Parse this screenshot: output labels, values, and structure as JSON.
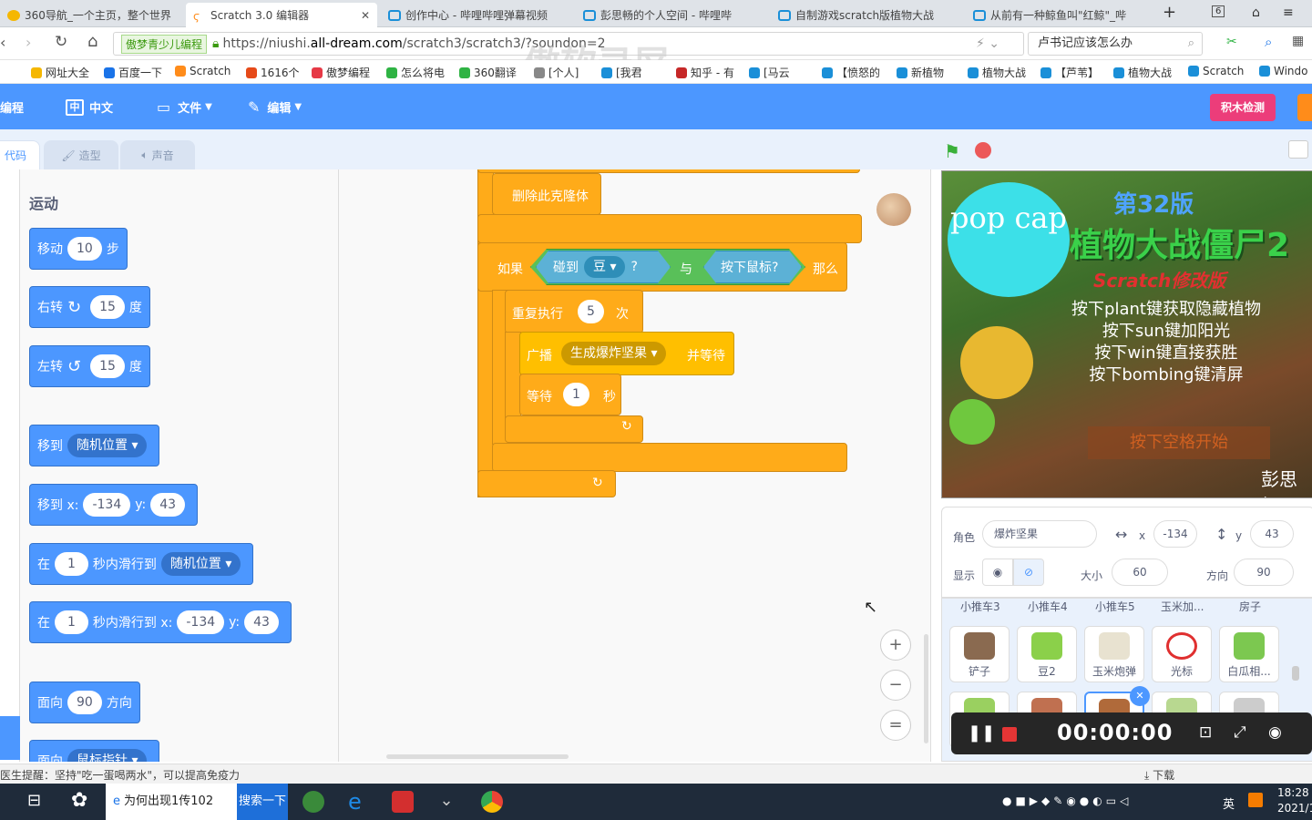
{
  "browser": {
    "tabs": [
      {
        "label": "360导航_一个主页，整个世界",
        "active": false
      },
      {
        "label": "Scratch 3.0 编辑器",
        "active": true
      },
      {
        "label": "创作中心 - 哔哩哔哩弹幕视频",
        "active": false
      },
      {
        "label": "彭思畅的个人空间 - 哔哩哔",
        "active": false
      },
      {
        "label": "自制游戏scratch版植物大战",
        "active": false
      },
      {
        "label": "从前有一种鲸鱼叫\"红鲸\"_哔",
        "active": false
      }
    ],
    "tab_count": "6",
    "badge": "傲梦青少儿编程",
    "url_prefix": "https://niushi.",
    "url_domain": "all-dream.com",
    "url_suffix": "/scratch3/scratch3/?soundon=2",
    "search_text": "卢书记应该怎么办",
    "bookmarks": [
      "网址大全",
      "百度一下",
      "Scratch",
      "1616个",
      "傲梦编程",
      "怎么将电",
      "360翻译",
      "[个人]",
      "[我君",
      "知乎 - 有",
      "[马云",
      "【愤怒的",
      "新植物",
      "植物大战",
      "【芦苇】",
      "植物大战",
      "Scratch",
      "Windo"
    ]
  },
  "menubar": {
    "logo": "编程",
    "language": "中文",
    "file": "文件",
    "edit": "编辑",
    "check_button": "积木检测"
  },
  "editor_tabs": {
    "code": "代码",
    "costume": "造型",
    "sound": "声音"
  },
  "palette": {
    "category": "运动",
    "blocks": {
      "move": {
        "a": "移动",
        "v": "10",
        "b": "步"
      },
      "turn_right": {
        "a": "右转",
        "icon": "↻",
        "v": "15",
        "b": "度"
      },
      "turn_left": {
        "a": "左转",
        "icon": "↺",
        "v": "15",
        "b": "度"
      },
      "goto": {
        "a": "移到",
        "dd": "随机位置 ▾"
      },
      "goto_xy": {
        "a": "移到 x:",
        "x": "-134",
        "yl": "y:",
        "y": "43"
      },
      "glide": {
        "a": "在",
        "v": "1",
        "b": "秒内滑行到",
        "dd": "随机位置 ▾"
      },
      "glide_xy": {
        "a": "在",
        "v": "1",
        "b": "秒内滑行到 x:",
        "x": "-134",
        "yl": "y:",
        "y": "43"
      },
      "point": {
        "a": "面向",
        "v": "90",
        "b": "方向"
      },
      "point_towards": {
        "a": "面向",
        "dd": "鼠标指针 ▾"
      }
    }
  },
  "script": {
    "delete_clone": "删除此克隆体",
    "if": "如果",
    "touching": "碰到",
    "touching_target": "豆 ▾",
    "touching_q": "?",
    "and": "与",
    "mouse_down": "按下鼠标?",
    "then": "那么",
    "repeat": "重复执行",
    "repeat_n": "5",
    "times": "次",
    "broadcast": "广播",
    "broadcast_msg": "生成爆炸坚果 ▾",
    "and_wait": "并等待",
    "wait": "等待",
    "wait_n": "1",
    "seconds": "秒"
  },
  "zoom": {
    "in": "+",
    "out": "−",
    "reset": "="
  },
  "stage": {
    "popcap": "pop cap",
    "version": "第32版",
    "title": "植物大战僵尸2",
    "subtitle": "Scratch修改版",
    "lines": [
      "按下plant键获取隐藏植物",
      "按下sun键加阳光",
      "按下win键直接获胜",
      "按下bombing键清屏"
    ],
    "start": "按下空格开始",
    "author": "彭思畅"
  },
  "sprite_info": {
    "sprite_label": "角色",
    "sprite_name": "爆炸坚果",
    "x_label": "x",
    "x": "-134",
    "y_label": "y",
    "y": "43",
    "show_label": "显示",
    "size_label": "大小",
    "size": "60",
    "direction_label": "方向",
    "direction": "90"
  },
  "sprites": {
    "top_row": [
      "小推车3",
      "小推车4",
      "小推车5",
      "玉米加...",
      "房子"
    ],
    "row": [
      "铲子",
      "豆2",
      "玉米炮弹",
      "光标",
      "白瓜相..."
    ]
  },
  "recorder": {
    "time": "00:00:00"
  },
  "status": {
    "tip": "医生提醒：坚持\"吃一蛋喝两水\"，可以提高免疫力",
    "download": "下载"
  },
  "taskbar": {
    "task1": "为何出现1传102",
    "search_btn": "搜索一下",
    "ime": "英",
    "time": "18:28",
    "date": "2021/1"
  },
  "watermark": "傲软录屏",
  "colors": {
    "scratch_blue": "#4c97ff",
    "motion": "#4c97ff",
    "control": "#ffab19",
    "sensing": "#5cb1d6",
    "operator": "#59c059",
    "event": "#ffbf00",
    "check_pink": "#ec3d7a"
  }
}
